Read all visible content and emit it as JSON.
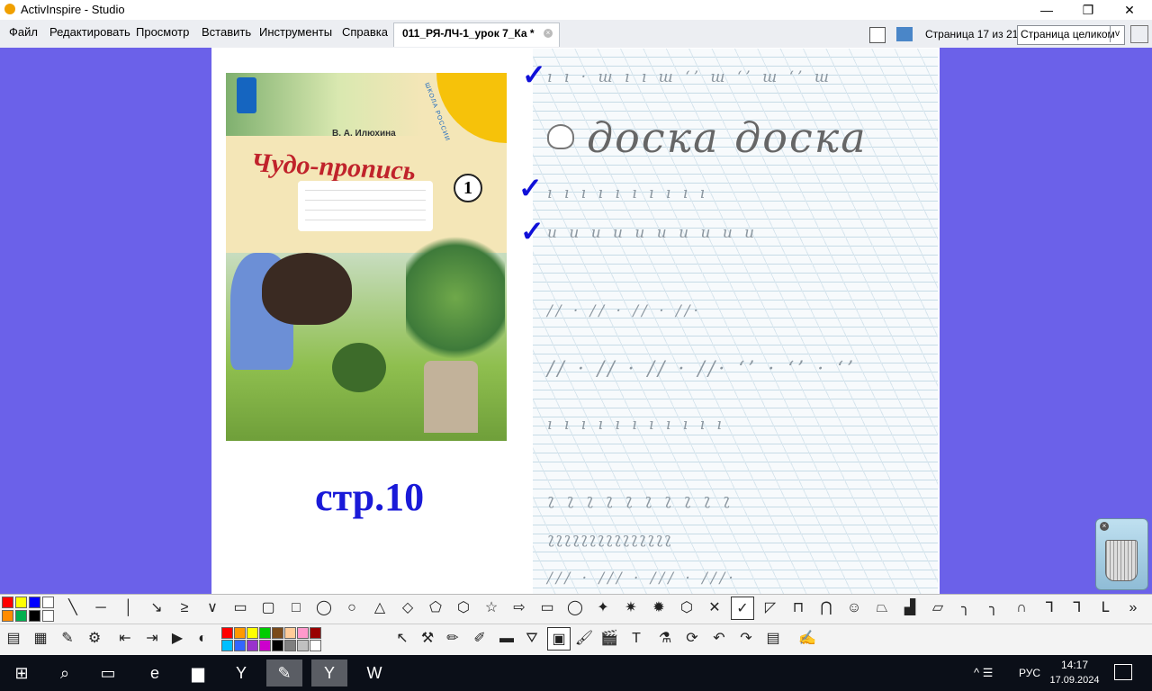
{
  "window": {
    "title": "ActivInspire - Studio",
    "minimize": "—",
    "restore": "❐",
    "close": "✕"
  },
  "menu": [
    "Файл",
    "Редактировать",
    "Просмотр",
    "Вставить",
    "Инструменты",
    "Справка"
  ],
  "doc_tab": {
    "label": "011_РЯ-ЛЧ-1_урок 7_Ка *",
    "close": "×"
  },
  "nav": {
    "page_indicator": "Страница 17 из 21",
    "zoom_value": "Страница целиком",
    "zoom_chevron": "v"
  },
  "cover": {
    "author": "В. А. Илюхина",
    "title": "Чудо-пропись",
    "volume": "1",
    "series": "ШКОЛА РОССИИ"
  },
  "page_label": "стр.10",
  "worksheet": {
    "rows": [
      "ı ı · ш  ı ı  ш  ‘’  ш  ‘’  ш ‘’ ш",
      "ı ı ı ı ı ı ı ı ı ı",
      "и и и и и и и и и и",
      "// · // · // · //·",
      "// · // · // · //·  ‘’ · ‘’ · ‘’",
      "ı ı ı ı ı ı ı ı ı ı ı",
      "ʅ ʅ ʅ ʅ ʅ ʅ ʅ ʅ ʅ ʅ",
      "ʅʅʅʅʅʅʅʅʅʅʅʅʅʅʅ",
      "/// · /// · /// · ///·"
    ],
    "big_word": "доска  доска",
    "check": "✓"
  },
  "trash": {
    "close": "×"
  },
  "shape_tools": [
    "╲",
    "─",
    "│",
    "↘",
    "≥",
    "∨",
    "▭",
    "▢",
    "□",
    "◯",
    "○",
    "△",
    "◇",
    "⬠",
    "⬡",
    "☆",
    "⇨",
    "▭",
    "◯",
    "✦",
    "✷",
    "✹",
    "⬡",
    "✕",
    "✓",
    "◸",
    "⊓",
    "⋂",
    "☺",
    "⏢",
    "▟",
    "▱",
    "╮",
    "╮",
    "∩",
    "ᒣ",
    "⅂",
    "ᒪ",
    "»"
  ],
  "main_tools": [
    "▤",
    "▦",
    "✎",
    "⚙",
    "⇤",
    "⇥",
    "▶",
    "◐",
    "↖",
    "⚒",
    "✏",
    "✐",
    "▬",
    "⛛",
    "▣",
    "🖌",
    "🎬",
    "T",
    "⚗",
    "⟳",
    "↶",
    "↷",
    "▤",
    "✍"
  ],
  "colors": {
    "left": [
      "#ff0000",
      "#ffff00",
      "#0000ff",
      "#ffffff",
      "#ff8c00",
      "#00b050",
      "#000000",
      "#ffffff"
    ],
    "palette": [
      "#ff0000",
      "#ff9900",
      "#ffff00",
      "#00cc00",
      "#7a4a1a",
      "#ffcc99",
      "#ff99cc",
      "#990000",
      "#00bfff",
      "#3366ff",
      "#9933cc",
      "#cc00cc",
      "#000000",
      "#808080",
      "#c0c0c0",
      "#ffffff"
    ]
  },
  "taskbar": {
    "icons": [
      "⊞",
      "⌕",
      "▭",
      "e",
      "▆",
      "Y",
      "✎",
      "Y",
      "W"
    ],
    "lang": "РУС",
    "time": "14:17",
    "date": "17.09.2024",
    "tray": "^ ☰"
  }
}
